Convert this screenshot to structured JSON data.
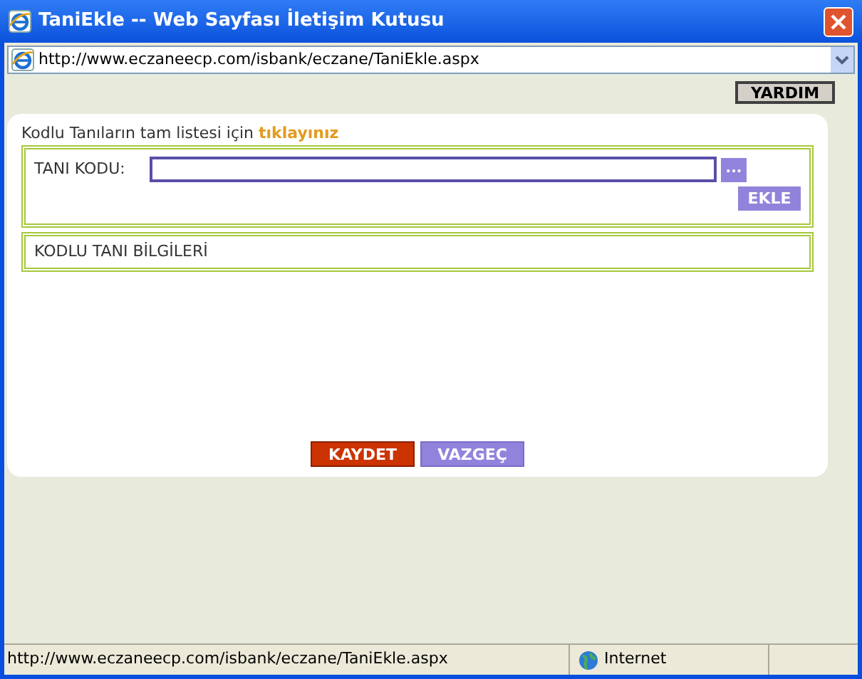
{
  "window": {
    "title": "TaniEkle -- Web Sayfası İletişim Kutusu"
  },
  "address_bar": {
    "url": "http://www.eczaneecp.com/isbank/eczane/TaniEkle.aspx"
  },
  "help_button": "YARDIM",
  "intro": {
    "text": "Kodlu Tanıların tam listesi için",
    "link": "tıklayınız"
  },
  "code_field": {
    "label": "TANI KODU:",
    "browse_button": "...",
    "add_button": "EKLE"
  },
  "info_section": {
    "title": "KODLU TANI BİLGİLERİ"
  },
  "buttons": [
    {
      "label": "KAYDET",
      "kind": "primary"
    },
    {
      "label": "VAZGEÇ",
      "kind": "secondary"
    }
  ],
  "status_bar": {
    "url": "http://www.eczaneecp.com/isbank/eczane/TaniEkle.aspx",
    "zone": "Internet"
  }
}
